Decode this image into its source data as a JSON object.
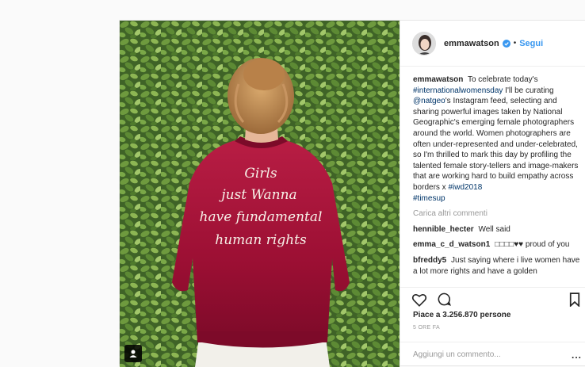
{
  "post": {
    "username": "emmawatson",
    "follow_label": "Segui",
    "separator": "•",
    "photo": {
      "jacket_text_lines": [
        "Girls",
        "just Wanna",
        "have fundamental",
        "human rights"
      ]
    },
    "caption": {
      "username": "emmawatson",
      "text_1": " To celebrate today's ",
      "hashtag_1": "#internationalwomensday",
      "text_2": " I'll be curating ",
      "mention": "@natgeo",
      "text_3": "'s Instagram feed, selecting and sharing powerful images taken by National Geographic's emerging female photographers around the world. Women photographers are often under-represented and under-celebrated, so I'm thrilled to mark this day by profiling the talented female story-tellers and image-makers that are working hard to build empathy across borders x ",
      "hashtag_2": "#iwd2018",
      "hashtag_3": "#timesup"
    },
    "load_more_label": "Carica altri commenti",
    "comments": [
      {
        "username": "hennible_hecter",
        "text": "Well said"
      },
      {
        "username": "emma_c_d_watson1",
        "text": "□□□□♥♥ proud of you"
      },
      {
        "username": "bfreddy5",
        "text": "Just saying where i live women have a lot more rights and have a golden"
      }
    ],
    "likes_label": "Piace a 3.256.870 persone",
    "time_label": "5 ORE FA",
    "add_comment_placeholder": "Aggiungi un commento...",
    "more_options_label": "...",
    "colors": {
      "accent": "#3897f0",
      "link": "#003569",
      "muted": "#999999",
      "jacket": "#a3123a"
    },
    "icons": [
      "verified-badge-icon",
      "heart-icon",
      "comment-icon",
      "bookmark-icon",
      "user-tag-icon"
    ]
  }
}
